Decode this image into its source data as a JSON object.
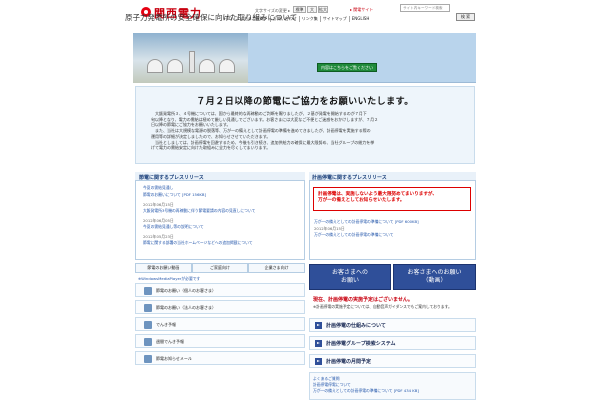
{
  "header": {
    "logo_text": "関西電力",
    "font_size_label": "文字サイズの変更 ▸",
    "font_sizes": [
      "標準",
      "大",
      "拡大"
    ],
    "kepco_link": "▸ 関電サイト",
    "search_placeholder": "サイト内キーワード検索",
    "search_button": "検 索",
    "nav": [
      "FAQ（よくあるご質問）",
      "お問い合わせ",
      "リンク集",
      "サイトマップ",
      "ENGLISH"
    ]
  },
  "banner": {
    "title": "原子力発電所の安全確保に向けた取り組みについて",
    "button": "内容はこちらをご覧ください"
  },
  "notice": {
    "title": "７月２日以降の節電にご協力をお願いいたします。",
    "body": [
      "　大飯発電所３、４号機については、国から最終的な再稼動のご判断を賜りましたが、２基が発電を開始するのが７月下",
      "旬以降となり、電力の需給は極めて厳しい見通しでございます。お客さまには大変なご不便とご迷惑をおかけしますが、７月２",
      "日以降の節電にご協力をお願いいたします。",
      "　また、当社は大規模な電源の脱落等、万が一の備えとして計画停電の準備を進めてきましたが、計画停電を実施する際の",
      "運用等の詳細が決定しましたので、お知らせさせていただきます。",
      "　当社としましては、計画停電を回避するため、今後も引き続き、追加供給力の確保に最大限努め、当社グループの総力を挙",
      "げて電力の需給安定に向けた取組みに全力を尽くしてまいります。"
    ]
  },
  "left_panel": {
    "title": "節電に関するプレスリリース",
    "items": [
      {
        "text": "今夏の需給見通し",
        "color": "blue"
      },
      {
        "text": "節電のお願いについて [PDF 156KB]",
        "color": "blue"
      },
      {
        "text": "2012年06月15日",
        "color": "gray"
      },
      {
        "text": "大飯発電所3号機の再稼動に伴う節電要請の内容の見直しについて",
        "color": "blue"
      },
      {
        "text": "2012年06月05日",
        "color": "gray"
      },
      {
        "text": "今夏の需給見通し等の説明について",
        "color": "blue"
      },
      {
        "text": "2012年05月23日",
        "color": "gray"
      },
      {
        "text": "節電に関する部署の当社ホームページなどへの追加掲載について",
        "color": "blue"
      }
    ],
    "tabs": [
      "節電のお願い動画",
      "ご家庭向け",
      "企業さま向け"
    ],
    "wmp_note": "※WindowsMediaPlayerが必要です",
    "links": [
      "節電のお願い（個人のお客さま）",
      "節電のお願い（法人のお客さま）",
      "でんき予報",
      "週間でんき予報",
      "節電お知らせメール"
    ]
  },
  "right_panel": {
    "title": "計画停電に関するプレスリリース",
    "alert": [
      "計画停電は、実施しないよう最大限努めてまいりますが、",
      "万が一の備えとしてお知らせいたします。"
    ],
    "items": [
      {
        "text": "万が一の備えとしての計画停電の準備について [PDF 600KB]",
        "color": "blue"
      },
      {
        "text": "2012年06月15日",
        "color": "gray"
      },
      {
        "text": "万が一の備えとしての計画停電の準備について",
        "color": "blue"
      }
    ],
    "contact_buttons": [
      {
        "line1": "お客さまへの",
        "line2": "お願い"
      },
      {
        "line1": "お客さまへのお願い",
        "line2": "（動画）"
      }
    ],
    "outage_status": "現在、計画停電の実施予定はございません。",
    "outage_sub": "※計画停電の実施予定については、自動音声ガイダンスでもご案内しております。",
    "links": [
      "計画停電の仕組みについて",
      "計画停電グループ検索システム",
      "計画停電の月間予定"
    ],
    "faq": [
      "よくあるご質問",
      "計画停電停電について",
      "万が一の備えとしての計画停電の準備について [PDF 434 KB]"
    ]
  },
  "colors": {
    "brand_red": "#c8000f",
    "link_blue": "#2255aa",
    "navy": "#2f4f99",
    "green": "#1f8a3a"
  }
}
